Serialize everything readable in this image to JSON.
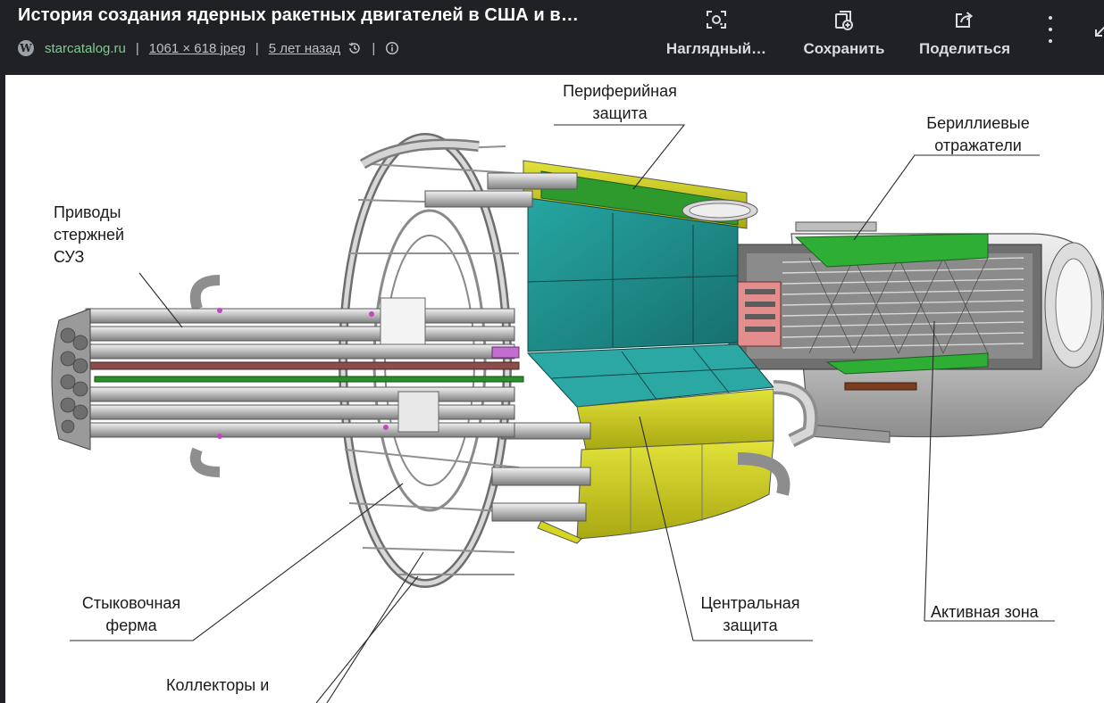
{
  "header": {
    "title": "История создания ядерных ракетных двигателей в США и в…",
    "source": "starcatalog.ru",
    "dimensions": "1061 × 618 jpeg",
    "age": "5 лет назад"
  },
  "actions": {
    "lens": "Наглядный…",
    "save": "Сохранить",
    "share": "Поделиться"
  },
  "diagram": {
    "labels": {
      "peripheral_1": "Периферийная",
      "peripheral_2": "защита",
      "beryllium_1": "Бериллиевые",
      "beryllium_2": "отражатели",
      "drives_1": "Приводы",
      "drives_2": "стержней",
      "drives_3": "СУЗ",
      "docking_1": "Стыковочная",
      "docking_2": "ферма",
      "central_1": "Центральная",
      "central_2": "защита",
      "core": "Активная зона",
      "collectors": "Коллекторы и"
    }
  },
  "colors": {
    "accent_green": "#81c995",
    "shield_teal": "#1f8f8c",
    "shield_yellow": "#d6d61e",
    "reflector_green": "#2fae36"
  }
}
